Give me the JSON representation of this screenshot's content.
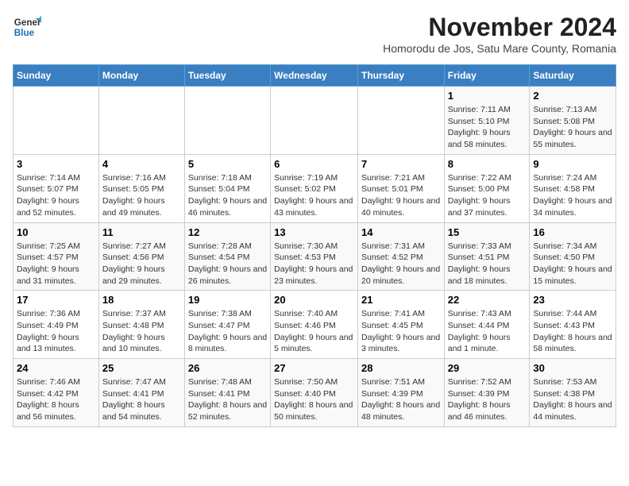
{
  "header": {
    "logo_line1": "General",
    "logo_line2": "Blue",
    "month_title": "November 2024",
    "subtitle": "Homorodu de Jos, Satu Mare County, Romania"
  },
  "weekdays": [
    "Sunday",
    "Monday",
    "Tuesday",
    "Wednesday",
    "Thursday",
    "Friday",
    "Saturday"
  ],
  "weeks": [
    [
      {
        "day": "",
        "info": ""
      },
      {
        "day": "",
        "info": ""
      },
      {
        "day": "",
        "info": ""
      },
      {
        "day": "",
        "info": ""
      },
      {
        "day": "",
        "info": ""
      },
      {
        "day": "1",
        "info": "Sunrise: 7:11 AM\nSunset: 5:10 PM\nDaylight: 9 hours and 58 minutes."
      },
      {
        "day": "2",
        "info": "Sunrise: 7:13 AM\nSunset: 5:08 PM\nDaylight: 9 hours and 55 minutes."
      }
    ],
    [
      {
        "day": "3",
        "info": "Sunrise: 7:14 AM\nSunset: 5:07 PM\nDaylight: 9 hours and 52 minutes."
      },
      {
        "day": "4",
        "info": "Sunrise: 7:16 AM\nSunset: 5:05 PM\nDaylight: 9 hours and 49 minutes."
      },
      {
        "day": "5",
        "info": "Sunrise: 7:18 AM\nSunset: 5:04 PM\nDaylight: 9 hours and 46 minutes."
      },
      {
        "day": "6",
        "info": "Sunrise: 7:19 AM\nSunset: 5:02 PM\nDaylight: 9 hours and 43 minutes."
      },
      {
        "day": "7",
        "info": "Sunrise: 7:21 AM\nSunset: 5:01 PM\nDaylight: 9 hours and 40 minutes."
      },
      {
        "day": "8",
        "info": "Sunrise: 7:22 AM\nSunset: 5:00 PM\nDaylight: 9 hours and 37 minutes."
      },
      {
        "day": "9",
        "info": "Sunrise: 7:24 AM\nSunset: 4:58 PM\nDaylight: 9 hours and 34 minutes."
      }
    ],
    [
      {
        "day": "10",
        "info": "Sunrise: 7:25 AM\nSunset: 4:57 PM\nDaylight: 9 hours and 31 minutes."
      },
      {
        "day": "11",
        "info": "Sunrise: 7:27 AM\nSunset: 4:56 PM\nDaylight: 9 hours and 29 minutes."
      },
      {
        "day": "12",
        "info": "Sunrise: 7:28 AM\nSunset: 4:54 PM\nDaylight: 9 hours and 26 minutes."
      },
      {
        "day": "13",
        "info": "Sunrise: 7:30 AM\nSunset: 4:53 PM\nDaylight: 9 hours and 23 minutes."
      },
      {
        "day": "14",
        "info": "Sunrise: 7:31 AM\nSunset: 4:52 PM\nDaylight: 9 hours and 20 minutes."
      },
      {
        "day": "15",
        "info": "Sunrise: 7:33 AM\nSunset: 4:51 PM\nDaylight: 9 hours and 18 minutes."
      },
      {
        "day": "16",
        "info": "Sunrise: 7:34 AM\nSunset: 4:50 PM\nDaylight: 9 hours and 15 minutes."
      }
    ],
    [
      {
        "day": "17",
        "info": "Sunrise: 7:36 AM\nSunset: 4:49 PM\nDaylight: 9 hours and 13 minutes."
      },
      {
        "day": "18",
        "info": "Sunrise: 7:37 AM\nSunset: 4:48 PM\nDaylight: 9 hours and 10 minutes."
      },
      {
        "day": "19",
        "info": "Sunrise: 7:38 AM\nSunset: 4:47 PM\nDaylight: 9 hours and 8 minutes."
      },
      {
        "day": "20",
        "info": "Sunrise: 7:40 AM\nSunset: 4:46 PM\nDaylight: 9 hours and 5 minutes."
      },
      {
        "day": "21",
        "info": "Sunrise: 7:41 AM\nSunset: 4:45 PM\nDaylight: 9 hours and 3 minutes."
      },
      {
        "day": "22",
        "info": "Sunrise: 7:43 AM\nSunset: 4:44 PM\nDaylight: 9 hours and 1 minute."
      },
      {
        "day": "23",
        "info": "Sunrise: 7:44 AM\nSunset: 4:43 PM\nDaylight: 8 hours and 58 minutes."
      }
    ],
    [
      {
        "day": "24",
        "info": "Sunrise: 7:46 AM\nSunset: 4:42 PM\nDaylight: 8 hours and 56 minutes."
      },
      {
        "day": "25",
        "info": "Sunrise: 7:47 AM\nSunset: 4:41 PM\nDaylight: 8 hours and 54 minutes."
      },
      {
        "day": "26",
        "info": "Sunrise: 7:48 AM\nSunset: 4:41 PM\nDaylight: 8 hours and 52 minutes."
      },
      {
        "day": "27",
        "info": "Sunrise: 7:50 AM\nSunset: 4:40 PM\nDaylight: 8 hours and 50 minutes."
      },
      {
        "day": "28",
        "info": "Sunrise: 7:51 AM\nSunset: 4:39 PM\nDaylight: 8 hours and 48 minutes."
      },
      {
        "day": "29",
        "info": "Sunrise: 7:52 AM\nSunset: 4:39 PM\nDaylight: 8 hours and 46 minutes."
      },
      {
        "day": "30",
        "info": "Sunrise: 7:53 AM\nSunset: 4:38 PM\nDaylight: 8 hours and 44 minutes."
      }
    ]
  ]
}
